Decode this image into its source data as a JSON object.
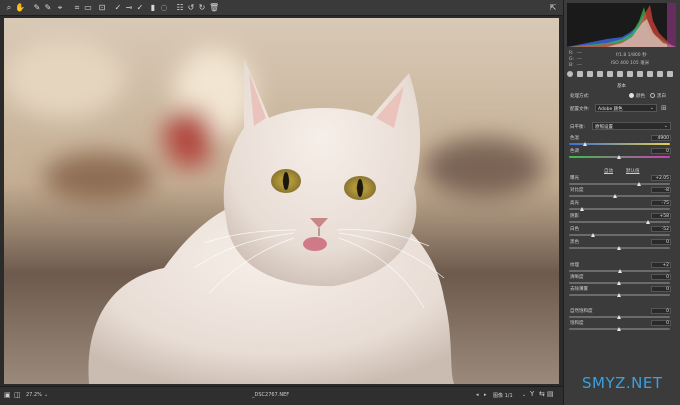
{
  "panel": {
    "readout": {
      "r_label": "R:",
      "g_label": "G:",
      "b_label": "B:",
      "r": "---",
      "g": "---",
      "b": "---",
      "line1": "f/1.8   1/800 秒",
      "line2": "ISO 400   105 毫米"
    },
    "basic_title": "基本",
    "process_label": "处理方式:",
    "process_color": "颜色",
    "process_bw": "黑白",
    "profile_label": "配置文件:",
    "profile_value": "Adobe 颜色",
    "wb_label": "白平衡:",
    "wb_value": "原照设置",
    "auto_label": "自动",
    "default_label": "默认值",
    "sliders": [
      {
        "label": "色温",
        "value": "4900",
        "pos": 0.16
      },
      {
        "label": "色调",
        "value": "0",
        "pos": 0.5
      },
      {
        "label": "曝光",
        "value": "+2.05",
        "pos": 0.7
      },
      {
        "label": "对比度",
        "value": "-8",
        "pos": 0.46
      },
      {
        "label": "高光",
        "value": "-75",
        "pos": 0.13
      },
      {
        "label": "阴影",
        "value": "+58",
        "pos": 0.79
      },
      {
        "label": "白色",
        "value": "-52",
        "pos": 0.24
      },
      {
        "label": "黑色",
        "value": "0",
        "pos": 0.5
      },
      {
        "label": "纹理",
        "value": "+2",
        "pos": 0.51
      },
      {
        "label": "清晰度",
        "value": "0",
        "pos": 0.5
      },
      {
        "label": "去除薄雾",
        "value": "0",
        "pos": 0.5
      },
      {
        "label": "自然饱和度",
        "value": "0",
        "pos": 0.5
      },
      {
        "label": "饱和度",
        "value": "0",
        "pos": 0.5
      }
    ]
  },
  "status": {
    "zoom": "27.2%",
    "filename": "_DSC2767.NEF",
    "nav": "图像 1/1"
  },
  "watermark": "SMYZ.NET",
  "colors": {
    "accent": "#3ba0e0"
  }
}
